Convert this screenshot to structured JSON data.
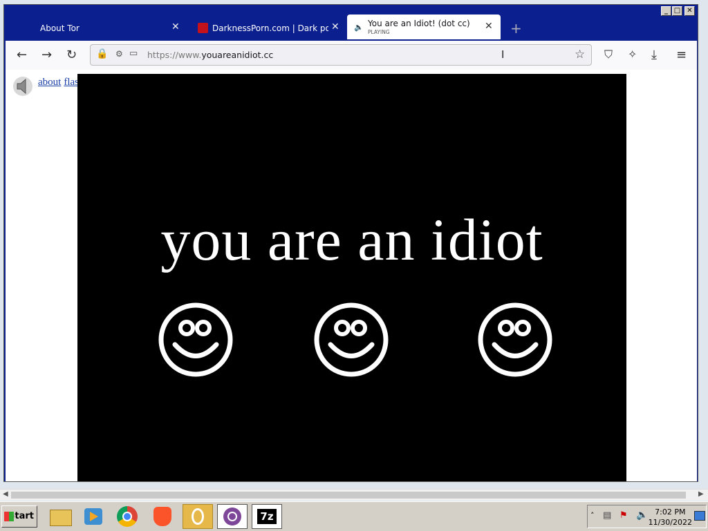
{
  "browser": {
    "tabs": [
      {
        "label": "About Tor",
        "close": "✕"
      },
      {
        "label": "DarknessPorn.com | Dark porn - br",
        "close": "✕"
      },
      {
        "label": "You are an Idiot! (dot cc)",
        "sublabel": "PLAYING",
        "close": "✕"
      }
    ],
    "new_tab": "+",
    "url_prefix": "https://www.",
    "url_domain": "youareanidiot.cc",
    "window_buttons": {
      "minimize": "_",
      "maximize": "□",
      "close": "✕"
    }
  },
  "page": {
    "links": [
      "about",
      "flash"
    ],
    "headline": "you are an idiot"
  },
  "taskbar": {
    "start_label": "Start",
    "app_icons": [
      "explorer-icon",
      "media-player-icon",
      "chrome-icon",
      "brave-icon",
      "tor-onion-icon",
      "tor-browser-icon",
      "7zip-icon"
    ],
    "seven_zip_label": "7z",
    "time": "7:02 PM",
    "date": "11/30/2022"
  },
  "colors": {
    "tabbar_bg": "#0b1f8f",
    "stage_bg": "#000000",
    "headline": "#ffffff",
    "link": "#1a3ea8"
  }
}
